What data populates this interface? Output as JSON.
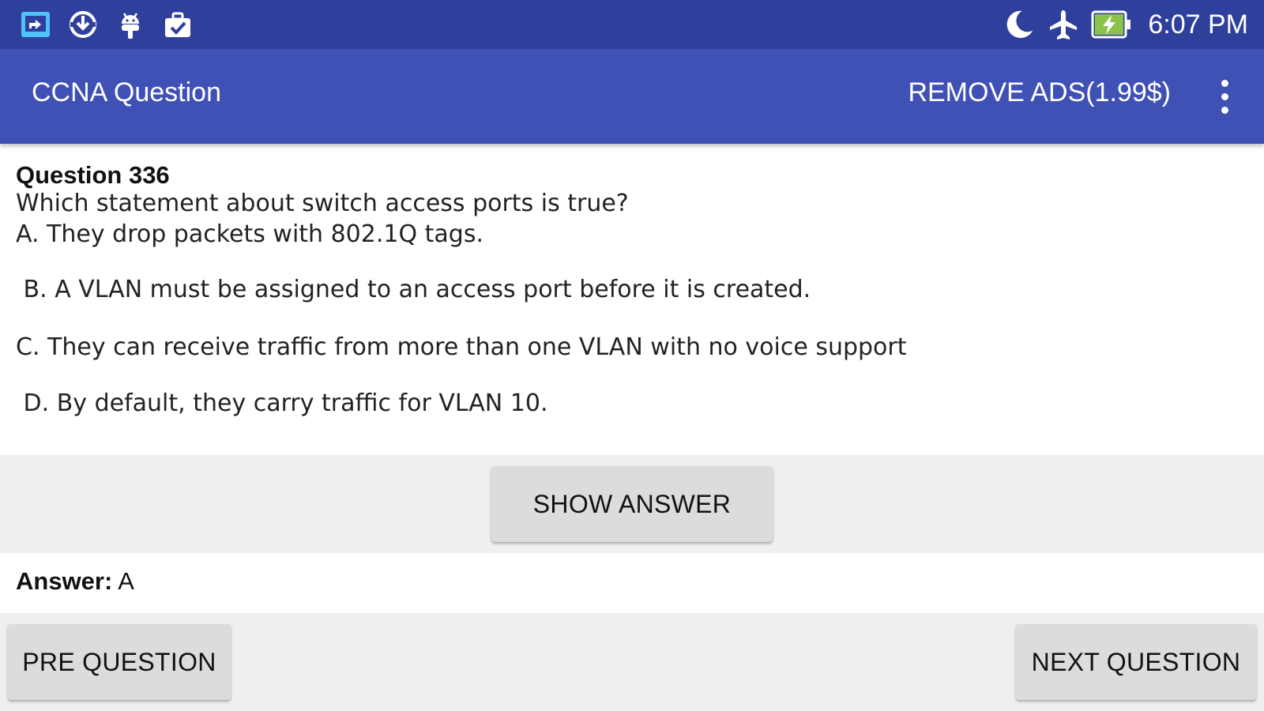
{
  "status_bar": {
    "time": "6:07 PM",
    "left_icons": [
      "screen-share-icon",
      "download-icon",
      "android-icon",
      "work-briefcase-icon"
    ],
    "right_icons": [
      "do-not-disturb-moon-icon",
      "airplane-mode-icon",
      "battery-charging-icon"
    ],
    "accent_color": "#8bc34a"
  },
  "app_bar": {
    "title": "CCNA Question",
    "remove_ads_label": "REMOVE ADS(1.99$)",
    "menu_icon": "overflow-menu-icon",
    "color": "#3f51b5"
  },
  "question": {
    "title": "Question 336",
    "text": "Which statement about switch access ports is true?",
    "options": [
      "A. They drop packets with 802.1Q tags.",
      " B. A VLAN must be assigned to an access port before it is created.",
      "C. They can receive traffic from more than one VLAN with no voice support",
      " D. By default, they carry traffic for VLAN 10."
    ]
  },
  "actions": {
    "show_answer_label": "SHOW ANSWER",
    "pre_question_label": "PRE QUESTION",
    "next_question_label": "NEXT QUESTION"
  },
  "answer": {
    "label": "Answer:",
    "value": "A"
  }
}
